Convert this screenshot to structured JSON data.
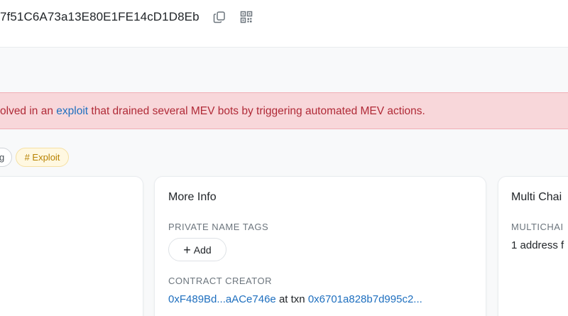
{
  "header": {
    "address": "7f51C6A73a13E80E1FE14cD1D8Eb",
    "copy_icon": "copy-icon",
    "qr_icon": "qr-code-icon"
  },
  "alert": {
    "prefix": "olved in an ",
    "link": "exploit",
    "suffix": " that drained several MEV bots by triggering automated MEV actions."
  },
  "tags": {
    "partial": "g",
    "exploit": "# Exploit"
  },
  "more_info": {
    "title": "More Info",
    "private_name_tags_label": "PRIVATE NAME TAGS",
    "add_label": "Add",
    "contract_creator_label": "CONTRACT CREATOR",
    "creator_address": "0xF489Bd...aACe746e",
    "at_txn": " at txn ",
    "txn_hash": "0x6701a828b7d995c2..."
  },
  "multichain": {
    "title": "Multi Chai",
    "label": "MULTICHAI",
    "value": "1 address f"
  },
  "colors": {
    "link": "#1e6fbf",
    "alert_bg": "#f8d7da",
    "alert_text": "#b02a37",
    "exploit_bg": "#fff8e1",
    "exploit_text": "#b78100"
  }
}
